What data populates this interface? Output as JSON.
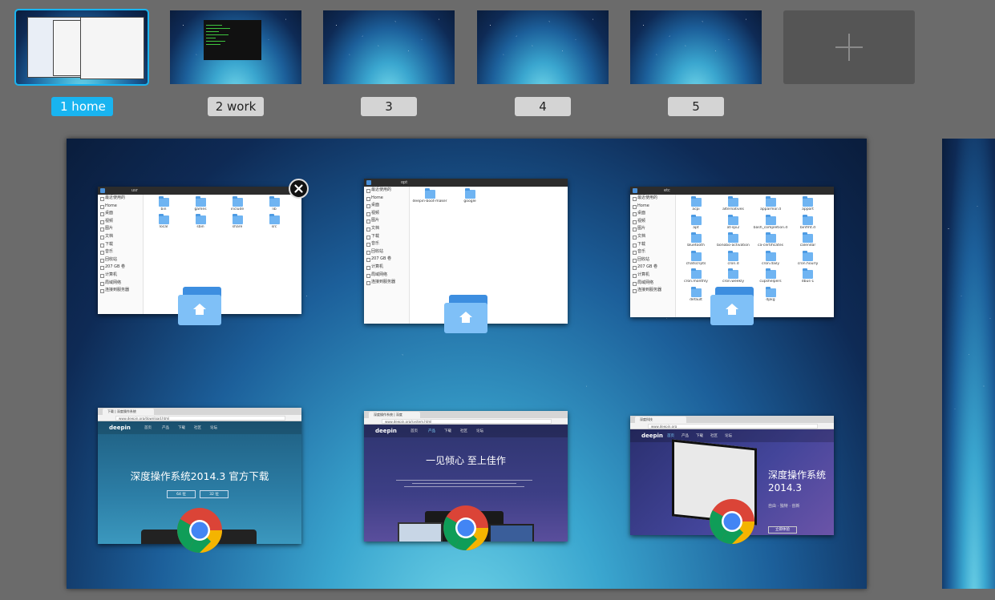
{
  "workspaces": [
    {
      "label": "1 home",
      "active": true
    },
    {
      "label": "2 work",
      "active": false
    },
    {
      "label": "3",
      "active": false
    },
    {
      "label": "4",
      "active": false
    },
    {
      "label": "5",
      "active": false
    }
  ],
  "add_workspace_icon": "plus-icon",
  "close_icon": "close-icon",
  "windows": {
    "fm_usr": {
      "path": "usr",
      "sidebar": [
        "最近使用的",
        "Home",
        "桌面",
        "视频",
        "图片",
        "文档",
        "下载",
        "音乐",
        "回收站",
        "207 GB 卷",
        "计算机",
        "局域网络",
        "连接到服务器"
      ],
      "folders": [
        "bin",
        "games",
        "include",
        "lib",
        "local",
        "sbin",
        "share",
        "src"
      ]
    },
    "fm_opt": {
      "path": "opt",
      "sidebar": [
        "最近使用的",
        "Home",
        "桌面",
        "视频",
        "图片",
        "文档",
        "下载",
        "音乐",
        "回收站",
        "207 GB 卷",
        "计算机",
        "局域网络",
        "连接到服务器"
      ],
      "folders": [
        "deepin-boot-maker",
        "google"
      ]
    },
    "fm_etc": {
      "path": "etc",
      "sidebar": [
        "最近使用的",
        "Home",
        "桌面",
        "视频",
        "图片",
        "文档",
        "下载",
        "音乐",
        "回收站",
        "207 GB 卷",
        "计算机",
        "局域网络",
        "连接到服务器"
      ],
      "folders": [
        "acpi",
        "alternatives",
        "apparmor.d",
        "apport",
        "apt",
        "at-spi2",
        "bash_completion.d",
        "binfmt.d",
        "bluetooth",
        "bonobo-activation",
        "ca-certificates",
        "calendar",
        "chatscripts",
        "cron.d",
        "cron.daily",
        "cron.hourly",
        "cron.monthly",
        "cron.weekly",
        "cupshelpers",
        "dbus-1",
        "default",
        "deepin-system-settings",
        "dpkg"
      ]
    },
    "br_download": {
      "tab": "下载 | 深度操作系统",
      "url": "www.deepin.org/download.html",
      "logo": "deepin",
      "nav": [
        "首页",
        "产品",
        "下载",
        "社区",
        "论坛"
      ],
      "headline": "深度操作系统2014.3 官方下载",
      "btn1": "64 位",
      "btn2": "32 位"
    },
    "br_system": {
      "tab": "深度操作系统 | 深度",
      "url": "www.deepin.org/system.html",
      "logo": "deepin",
      "nav": [
        "首页",
        "产品",
        "下载",
        "社区",
        "论坛"
      ],
      "headline": "一见倾心 至上佳作"
    },
    "br_home": {
      "tab": "深度科技",
      "url": "www.deepin.org",
      "logo": "deepin",
      "nav": [
        "首页",
        "产品",
        "下载",
        "社区",
        "论坛"
      ],
      "headline": "深度操作系统",
      "version": "2014.3",
      "tagline": "自由 · 独特 · 创新",
      "cta": "立即体验"
    }
  }
}
